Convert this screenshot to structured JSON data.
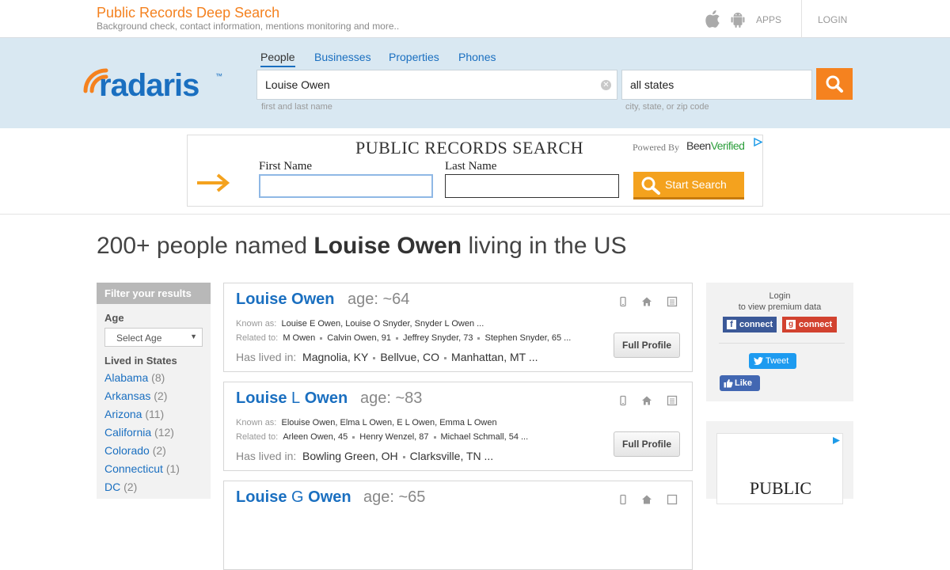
{
  "header": {
    "site_title": "Public Records Deep Search",
    "site_subtitle": "Background check, contact information, mentions monitoring and more..",
    "apps_label": "APPS",
    "login_label": "LOGIN"
  },
  "logo": {
    "text": "radaris",
    "trademark": "™"
  },
  "search": {
    "tabs": [
      {
        "label": "People",
        "active": true
      },
      {
        "label": "Businesses",
        "active": false
      },
      {
        "label": "Properties",
        "active": false
      },
      {
        "label": "Phones",
        "active": false
      }
    ],
    "name_value": "Louise Owen",
    "name_hint": "first and last name",
    "location_value": "all states",
    "location_hint": "city, state, or zip code"
  },
  "ad": {
    "title": "PUBLIC RECORDS SEARCH",
    "powered_by": "Powered By",
    "brand_a": "Been",
    "brand_b": "Verified",
    "first_name_label": "First Name",
    "last_name_label": "Last Name",
    "start_button": "Start Search"
  },
  "results": {
    "headline_prefix": "200+ people named ",
    "headline_name": "Louise Owen",
    "headline_suffix": " living in the US"
  },
  "filters": {
    "title": "Filter your results",
    "age_label": "Age",
    "age_select": "Select Age",
    "states_label": "Lived in States",
    "states": [
      {
        "name": "Alabama",
        "count": "(8)"
      },
      {
        "name": "Arkansas",
        "count": "(2)"
      },
      {
        "name": "Arizona",
        "count": "(11)"
      },
      {
        "name": "California",
        "count": "(12)"
      },
      {
        "name": "Colorado",
        "count": "(2)"
      },
      {
        "name": "Connecticut",
        "count": "(1)"
      },
      {
        "name": "DC",
        "count": "(2)"
      }
    ]
  },
  "cards": [
    {
      "first": "Louise",
      "middle": "",
      "last": "Owen",
      "age": "age: ~64",
      "known_as_label": "Known as:",
      "known_as": "Louise E Owen, Louise O Snyder, Snyder L Owen ...",
      "related_label": "Related to:",
      "related": [
        "M Owen",
        "Calvin Owen, 91",
        "Jeffrey Snyder, 73",
        "Stephen Snyder, 65 ..."
      ],
      "lived_label": "Has lived in:",
      "lived": [
        "Magnolia, KY",
        "Bellvue, CO",
        "Manhattan, MT ..."
      ],
      "button": "Full Profile"
    },
    {
      "first": "Louise",
      "middle": "L",
      "last": "Owen",
      "age": "age: ~83",
      "known_as_label": "Known as:",
      "known_as": "Elouise Owen, Elma L Owen, E L Owen, Emma L Owen",
      "related_label": "Related to:",
      "related": [
        "Arleen Owen, 45",
        "Henry Wenzel, 87",
        "Michael Schmall, 54 ..."
      ],
      "lived_label": "Has lived in:",
      "lived": [
        "Bowling Green, OH",
        "Clarksville, TN ..."
      ],
      "button": "Full Profile"
    },
    {
      "first": "Louise",
      "middle": "G",
      "last": "Owen",
      "age": "age: ~65"
    }
  ],
  "sidebar": {
    "login_line1": "Login",
    "login_line2": "to view premium data",
    "fb_connect": "connect",
    "g_connect": "connect",
    "tweet": "Tweet",
    "like": "Like",
    "ad_title": "PUBLIC"
  },
  "colors": {
    "accent": "#f5821f",
    "link": "#1a6fc0",
    "band": "#d9e8f2"
  }
}
